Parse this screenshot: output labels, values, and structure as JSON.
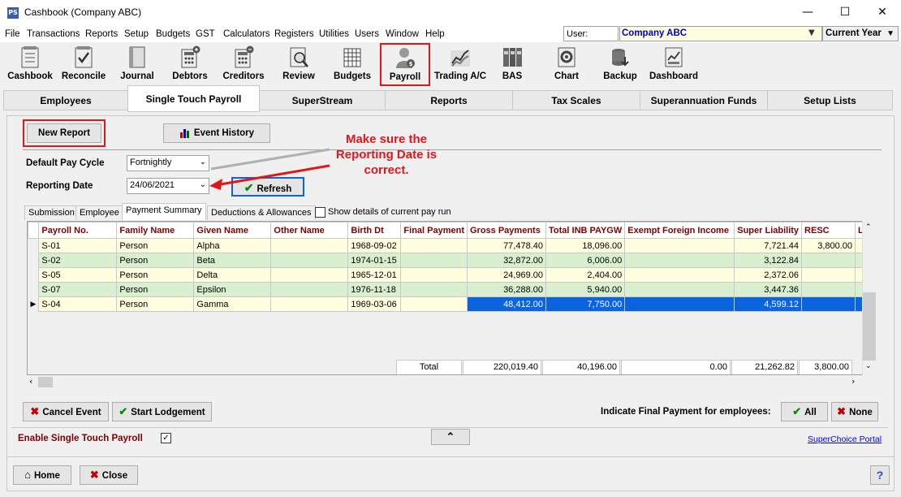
{
  "window": {
    "title": "Cashbook (Company ABC)",
    "icon_text": "PS",
    "minimize": "—",
    "maximize": "☐",
    "close": "✕"
  },
  "menu": [
    "File",
    "Transactions",
    "Reports",
    "Setup",
    "Budgets",
    "GST",
    "Calculators",
    "Registers",
    "Utilities",
    "Users",
    "Window",
    "Help"
  ],
  "user_label": "User:",
  "company": "Company ABC",
  "year_selector": "Current Year",
  "toolbar": [
    "Cashbook",
    "Reconcile",
    "Journal",
    "Debtors",
    "Creditors",
    "Review",
    "Budgets",
    "Payroll",
    "Trading A/C",
    "BAS",
    "Chart",
    "Backup",
    "Dashboard"
  ],
  "tabs": [
    "Employees",
    "Single Touch Payroll",
    "SuperStream",
    "Reports",
    "Tax Scales",
    "Superannuation Funds",
    "Setup Lists"
  ],
  "buttons": {
    "new_report": "New Report",
    "event_history": "Event History",
    "refresh": "Refresh",
    "cancel_event": "Cancel Event",
    "start_lodgement": "Start Lodgement",
    "all": "All",
    "none": "None",
    "home": "Home",
    "close": "Close",
    "help": "?"
  },
  "labels": {
    "default_pay_cycle": "Default Pay Cycle",
    "reporting_date": "Reporting Date",
    "indicate_final": "Indicate Final Payment for employees:",
    "enable_stp": "Enable Single Touch Payroll",
    "show_details": "Show details of current pay run"
  },
  "fields": {
    "pay_cycle": "Fortnightly",
    "reporting_date": "24/06/2021"
  },
  "annotation": "Make sure the Reporting Date is correct.",
  "subtabs": [
    "Submission",
    "Employee",
    "Payment Summary",
    "Deductions & Allowances"
  ],
  "grid": {
    "columns": [
      "Payroll No.",
      "Family Name",
      "Given Name",
      "Other Name",
      "Birth Dt",
      "Final Payment",
      "Gross Payments",
      "Total INB PAYGW",
      "Exempt Foreign Income",
      "Super Liability",
      "RESC",
      "Lu"
    ],
    "rows": [
      {
        "payroll_no": "S-01",
        "family": "Person",
        "given": "Alpha",
        "other": "",
        "birth": "1968-09-02",
        "final": "",
        "gross": "77,478.40",
        "paygw": "18,096.00",
        "exempt": "",
        "super": "7,721.44",
        "resc": "3,800.00"
      },
      {
        "payroll_no": "S-02",
        "family": "Person",
        "given": "Beta",
        "other": "",
        "birth": "1974-01-15",
        "final": "",
        "gross": "32,872.00",
        "paygw": "6,006.00",
        "exempt": "",
        "super": "3,122.84",
        "resc": ""
      },
      {
        "payroll_no": "S-05",
        "family": "Person",
        "given": "Delta",
        "other": "",
        "birth": "1965-12-01",
        "final": "",
        "gross": "24,969.00",
        "paygw": "2,404.00",
        "exempt": "",
        "super": "2,372.06",
        "resc": ""
      },
      {
        "payroll_no": "S-07",
        "family": "Person",
        "given": "Epsilon",
        "other": "",
        "birth": "1976-11-18",
        "final": "",
        "gross": "36,288.00",
        "paygw": "5,940.00",
        "exempt": "",
        "super": "3,447.36",
        "resc": ""
      },
      {
        "payroll_no": "S-04",
        "family": "Person",
        "given": "Gamma",
        "other": "",
        "birth": "1969-03-06",
        "final": "",
        "gross": "48,412.00",
        "paygw": "7,750.00",
        "exempt": "",
        "super": "4,599.12",
        "resc": ""
      }
    ],
    "total": {
      "label": "Total",
      "gross": "220,019.40",
      "paygw": "40,196.00",
      "exempt": "0.00",
      "super": "21,262.82",
      "resc": "3,800.00"
    }
  },
  "link": "SuperChoice Portal"
}
